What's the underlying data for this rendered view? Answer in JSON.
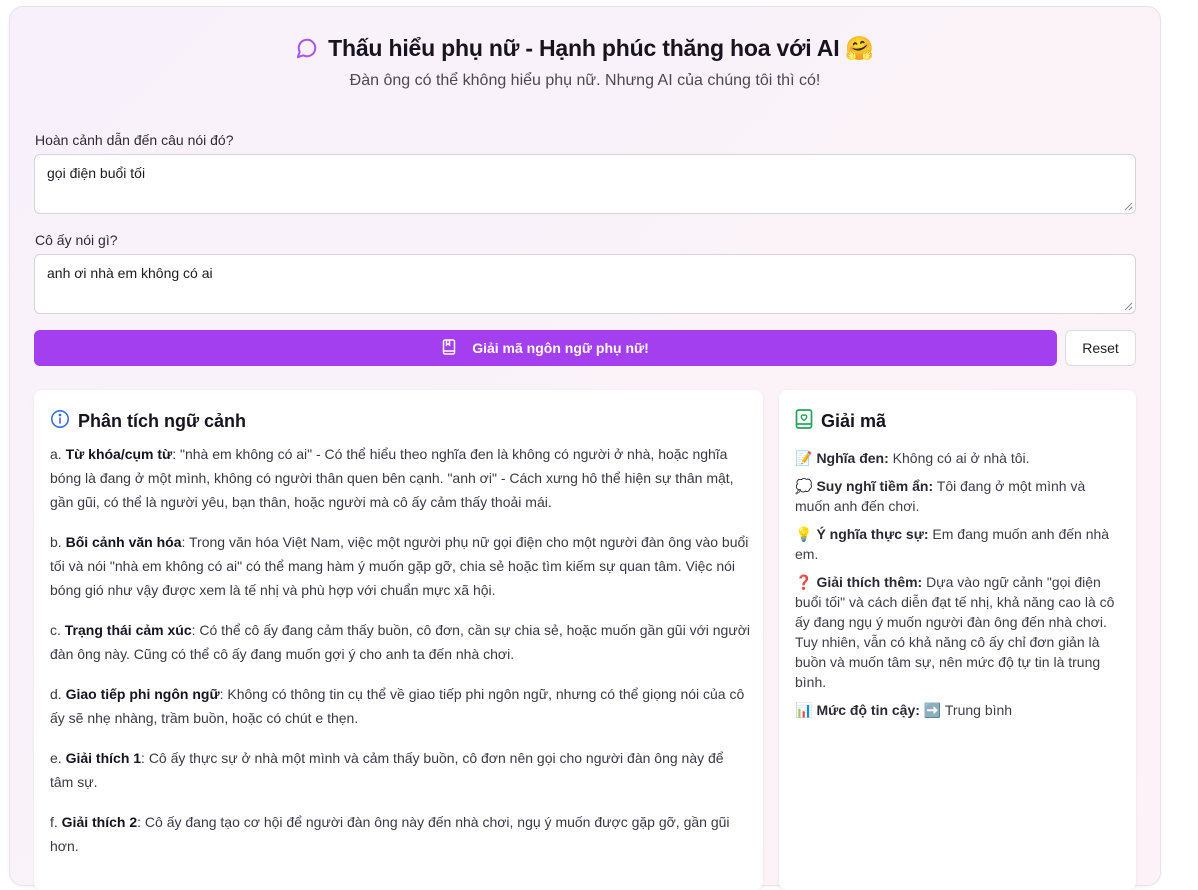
{
  "header": {
    "title": "Thấu hiểu phụ nữ - Hạnh phúc thăng hoa với AI",
    "title_emoji": "🤗",
    "subtitle": "Đàn ông có thể không hiểu phụ nữ. Nhưng AI của chúng tôi thì có!",
    "icon": "chat-bubble-icon"
  },
  "form": {
    "context_label": "Hoàn cảnh dẫn đến câu nói đó?",
    "context_value": "gọi điện buổi tối",
    "quote_label": "Cô ấy nói gì?",
    "quote_value": "anh ơi nhà em không có ai",
    "decode_button_label": "Giải mã ngôn ngữ phụ nữ!",
    "decode_button_icon": "book-icon",
    "reset_button_label": "Reset"
  },
  "analysis": {
    "title": "Phân tích ngữ cảnh",
    "icon": "info-icon",
    "items": [
      {
        "prefix": "a. ",
        "label": "Từ khóa/cụm từ",
        "text": ": \"nhà em không có ai\" - Có thể hiểu theo nghĩa đen là không có người ở nhà, hoặc nghĩa bóng là đang ở một mình, không có người thân quen bên cạnh. \"anh ơi\" - Cách xưng hô thể hiện sự thân mật, gần gũi, có thể là người yêu, bạn thân, hoặc người mà cô ấy cảm thấy thoải mái."
      },
      {
        "prefix": "b. ",
        "label": "Bối cảnh văn hóa",
        "text": ": Trong văn hóa Việt Nam, việc một người phụ nữ gọi điện cho một người đàn ông vào buổi tối và nói \"nhà em không có ai\" có thể mang hàm ý muốn gặp gỡ, chia sẻ hoặc tìm kiếm sự quan tâm. Việc nói bóng gió như vậy được xem là tế nhị và phù hợp với chuẩn mực xã hội."
      },
      {
        "prefix": "c. ",
        "label": "Trạng thái cảm xúc",
        "text": ": Có thể cô ấy đang cảm thấy buồn, cô đơn, cần sự chia sẻ, hoặc muốn gần gũi với người đàn ông này. Cũng có thể cô ấy đang muốn gợi ý cho anh ta đến nhà chơi."
      },
      {
        "prefix": "d. ",
        "label": "Giao tiếp phi ngôn ngữ",
        "text": ": Không có thông tin cụ thể về giao tiếp phi ngôn ngữ, nhưng có thể giọng nói của cô ấy sẽ nhẹ nhàng, trầm buồn, hoặc có chút e thẹn."
      },
      {
        "prefix": "e. ",
        "label": "Giải thích 1",
        "text": ": Cô ấy thực sự ở nhà một mình và cảm thấy buồn, cô đơn nên gọi cho người đàn ông này để tâm sự."
      },
      {
        "prefix": "f. ",
        "label": "Giải thích 2",
        "text": ": Cô ấy đang tạo cơ hội để người đàn ông này đến nhà chơi, ngụ ý muốn được gặp gỡ, gần gũi hơn."
      }
    ]
  },
  "decode": {
    "title": "Giải mã",
    "icon": "book-heart-icon",
    "items": [
      {
        "emoji": "📝",
        "label": "Nghĩa đen:",
        "text": " Không có ai ở nhà tôi."
      },
      {
        "emoji": "💭",
        "label": "Suy nghĩ tiềm ẩn:",
        "text": " Tôi đang ở một mình và muốn anh đến chơi."
      },
      {
        "emoji": "💡",
        "label": "Ý nghĩa thực sự:",
        "text": " Em đang muốn anh đến nhà em."
      },
      {
        "emoji": "❓",
        "label": "Giải thích thêm:",
        "text": " Dựa vào ngữ cảnh \"gọi điện buổi tối\" và cách diễn đạt tế nhị, khả năng cao là cô ấy đang ngụ ý muốn người đàn ông đến nhà chơi. Tuy nhiên, vẫn có khả năng cô ấy chỉ đơn giản là buồn và muốn tâm sự, nên mức độ tự tin là trung bình."
      },
      {
        "emoji": "📊",
        "label": "Mức độ tin cậy:",
        "text": " ➡️ Trung bình"
      }
    ]
  },
  "colors": {
    "accent": "#a43ff0",
    "accent_icon": "#a855f7",
    "info_icon": "#3b6fd8",
    "decode_icon": "#22a45a"
  }
}
